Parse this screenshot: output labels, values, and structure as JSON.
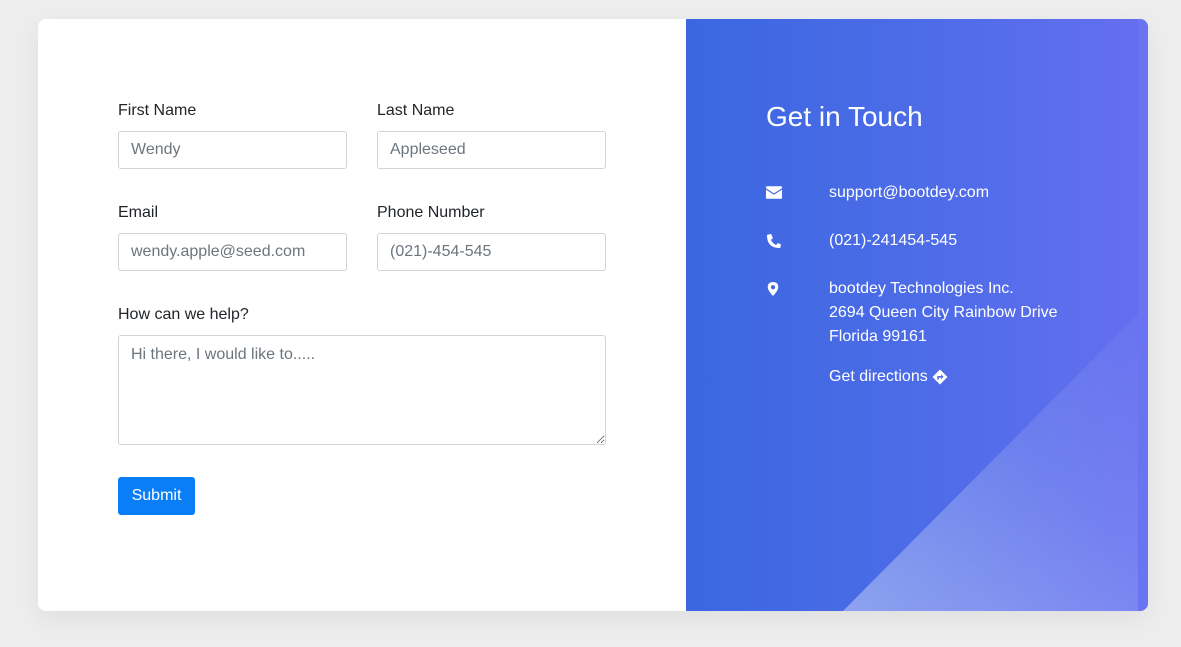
{
  "form": {
    "first_name": {
      "label": "First Name",
      "placeholder": "Wendy"
    },
    "last_name": {
      "label": "Last Name",
      "placeholder": "Appleseed"
    },
    "email": {
      "label": "Email",
      "placeholder": "wendy.apple@seed.com"
    },
    "phone": {
      "label": "Phone Number",
      "placeholder": "(021)-454-545"
    },
    "message": {
      "label": "How can we help?",
      "placeholder": "Hi there, I would like to....."
    },
    "submit_label": "Submit"
  },
  "contact": {
    "title": "Get in Touch",
    "email": {
      "icon": "envelope-icon",
      "text": "support@bootdey.com"
    },
    "phone": {
      "icon": "phone-icon",
      "text": "(021)-241454-545"
    },
    "address": {
      "icon": "map-marker-icon",
      "line1": "bootdey Technologies Inc.",
      "line2": "2694 Queen City Rainbow Drive",
      "line3": "Florida 99161"
    },
    "directions_label": "Get directions",
    "directions_icon": "directions-icon"
  },
  "colors": {
    "accent": "#0a7ef6",
    "panel_start": "#3a67e0",
    "panel_end": "#656ff0",
    "background": "#ededed"
  }
}
